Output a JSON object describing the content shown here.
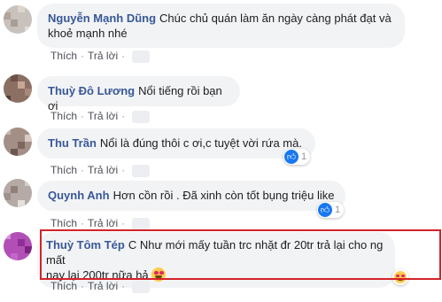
{
  "actions": {
    "like": "Thích",
    "reply": "Trả lời",
    "separator": "·"
  },
  "comments": [
    {
      "author": "Nguyễn Mạnh Dũng",
      "text": "Chúc chủ quán làm ăn ngày càng phát đạt và khoẻ mạnh nhé",
      "reactions": ""
    },
    {
      "author": "Thuỳ Đô Lương",
      "text": "Nổi tiếng rồi bạn ơi",
      "reactions": ""
    },
    {
      "author": "Thu Trần",
      "text": "Nổi là đúng thôi c ơi,c tuyệt vời rứa mà.",
      "reactions": "1"
    },
    {
      "author": "Quynh Anh",
      "text": "Hơn cồn rồi . Đã xinh còn tốt bụng triệu like",
      "reactions": "1"
    },
    {
      "author": "Thuỳ Tôm Tép",
      "text_line1": "C Như mới mấy tuần trc nhặt đr 20tr trả lại cho ng mất",
      "text_line2": "nay lại 200tr nữa hả",
      "reactions": ""
    }
  ],
  "colors": {
    "author": "#385898",
    "bubble": "#f2f3f5",
    "highlight": "#d3232a",
    "like": "#1877f2"
  },
  "icons": [
    "like-icon",
    "heart-eyes-emoji-icon"
  ]
}
